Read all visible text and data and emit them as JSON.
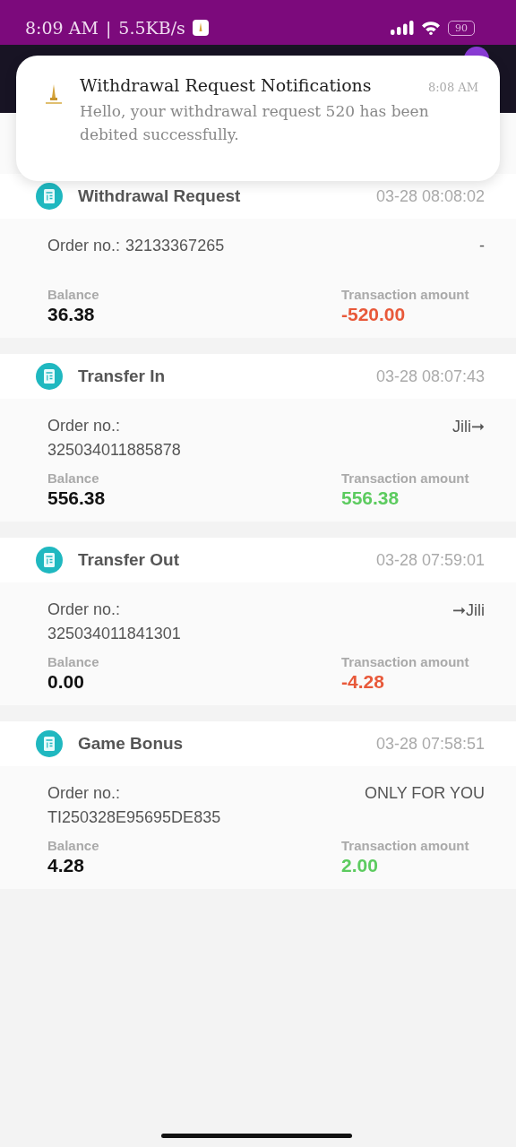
{
  "status_bar": {
    "time": "8:09 AM",
    "separator": "|",
    "speed": "5.5KB/s",
    "battery": "90"
  },
  "notification": {
    "title": "Withdrawal Request Notifications",
    "time": "8:08 AM",
    "body": "Hello, your withdrawal request 520 has been debited successfully."
  },
  "transactions": [
    {
      "title": "Withdrawal Request",
      "datetime": "03-28 08:08:02",
      "order_label": "Order no.:",
      "order_number": "32133367265",
      "note": "-",
      "balance_label": "Balance",
      "balance": "36.38",
      "amount_label": "Transaction amount",
      "amount": "-520.00",
      "kind": "debit"
    },
    {
      "title": "Transfer In",
      "datetime": "03-28 08:07:43",
      "order_label": "Order no.:",
      "order_number": "325034011885878",
      "note": "Jili➞",
      "balance_label": "Balance",
      "balance": "556.38",
      "amount_label": "Transaction amount",
      "amount": "556.38",
      "kind": "credit"
    },
    {
      "title": "Transfer Out",
      "datetime": "03-28 07:59:01",
      "order_label": "Order no.:",
      "order_number": "325034011841301",
      "note": "➞Jili",
      "balance_label": "Balance",
      "balance": "0.00",
      "amount_label": "Transaction amount",
      "amount": "-4.28",
      "kind": "debit"
    },
    {
      "title": "Game Bonus",
      "datetime": "03-28 07:58:51",
      "order_label": "Order no.:",
      "order_number": "TI250328E95695DE835",
      "note": "ONLY FOR YOU",
      "balance_label": "Balance",
      "balance": "4.28",
      "amount_label": "Transaction amount",
      "amount": "2.00",
      "kind": "credit"
    }
  ]
}
